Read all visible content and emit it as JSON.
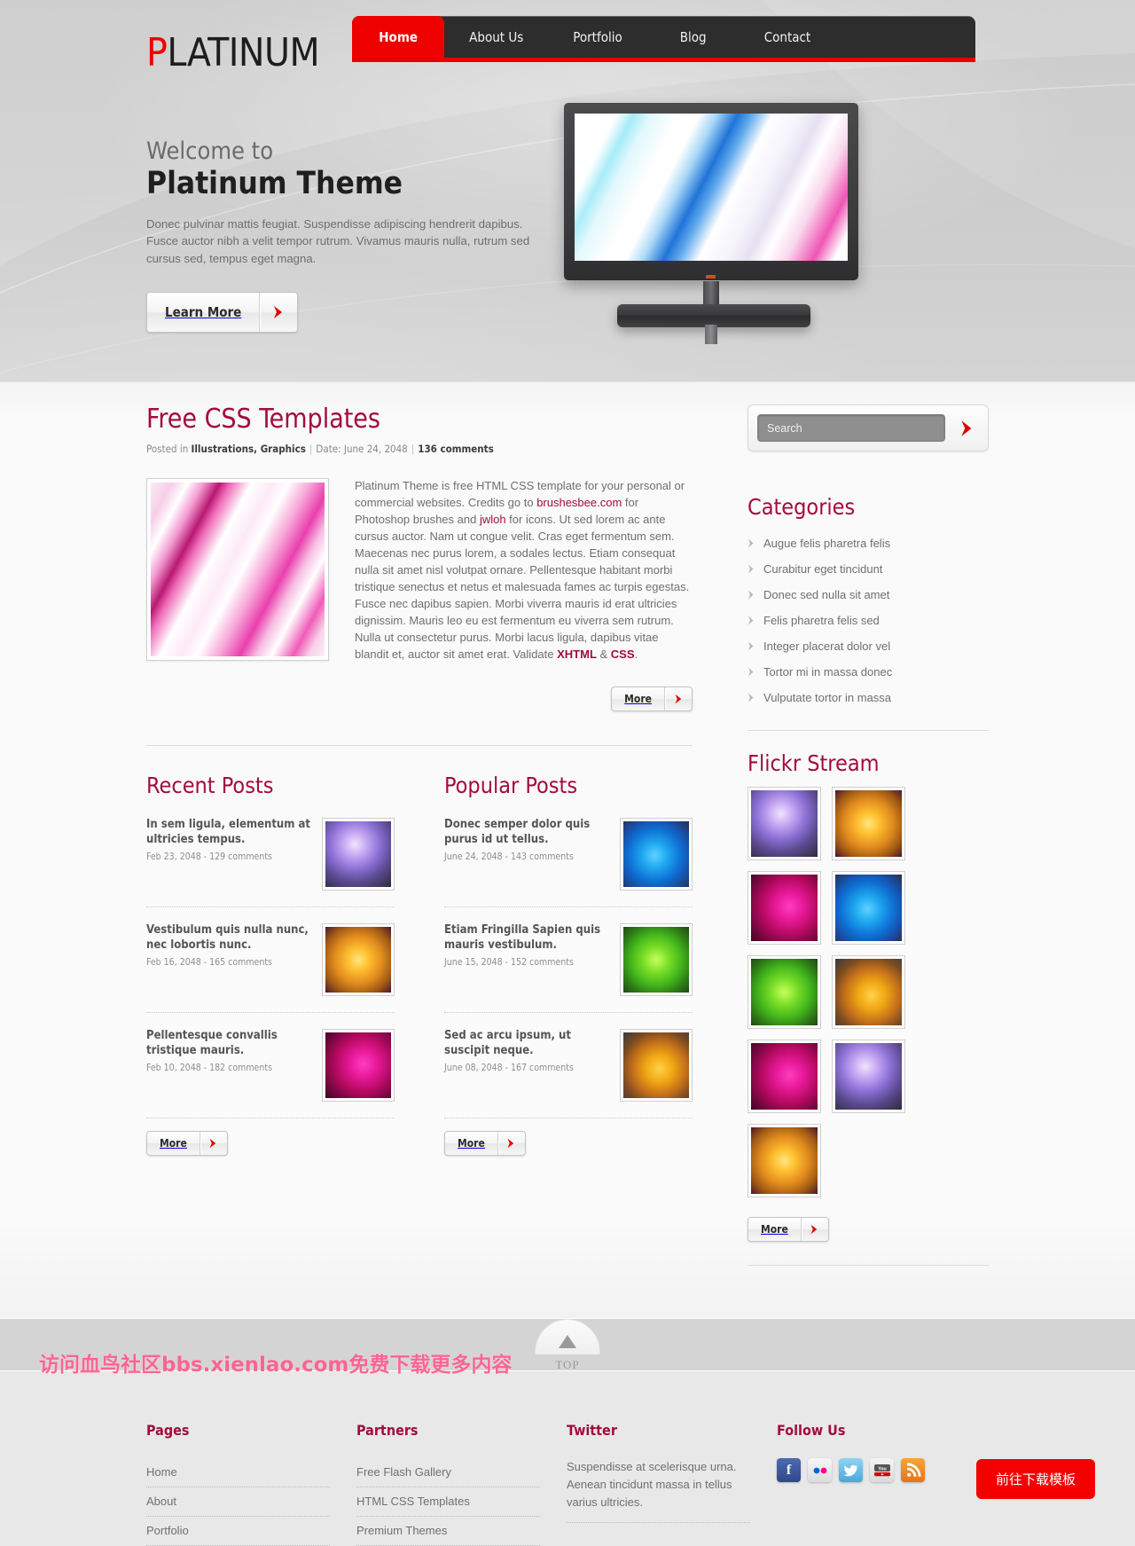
{
  "brand": {
    "first_letter": "P",
    "rest": "LATINUM"
  },
  "nav": [
    {
      "label": "Home",
      "active": true
    },
    {
      "label": "About Us",
      "active": false
    },
    {
      "label": "Portfolio",
      "active": false
    },
    {
      "label": "Blog",
      "active": false
    },
    {
      "label": "Contact",
      "active": false
    }
  ],
  "hero": {
    "subtitle": "Welcome to",
    "title": "Platinum Theme",
    "paragraph": "Donec pulvinar mattis feugiat. Suspendisse adipiscing hendrerit dapibus. Fusce auctor nibh a velit tempor rutrum. Vivamus mauris nulla, rutrum sed cursus sed, tempus eget magna.",
    "cta_label": "Learn More"
  },
  "post": {
    "title": "Free CSS Templates",
    "meta_prefix": "Posted in ",
    "categories": "Illustrations, Graphics",
    "date": "Date: June 24, 2048",
    "comments": "136 comments",
    "body_1": "Platinum Theme is free HTML CSS template for your personal or commercial websites. Credits go to ",
    "link_1": "brushesbee.com",
    "body_2": " for Photoshop brushes and ",
    "link_2": "jwloh",
    "body_3": " for icons. Ut sed lorem ac ante cursus auctor. Nam ut congue velit. Cras eget fermentum sem. Maecenas nec purus lorem, a sodales lectus. Etiam consequat nulla sit amet nisl volutpat ornare. Pellentesque habitant morbi tristique senectus et netus et malesuada fames ac turpis egestas. Fusce nec dapibus sapien. Morbi viverra mauris id erat ultricies dignissim. Mauris leo eu est fermentum eu viverra sem rutrum. Nulla ut consectetur purus. Morbi lacus ligula, dapibus vitae blandit et, auctor sit amet erat. Validate ",
    "strong_1": "XHTML",
    "body_4": " & ",
    "strong_2": "CSS",
    "body_5": ".",
    "more_label": "More"
  },
  "recent": {
    "title": "Recent Posts",
    "more_label": "More",
    "items": [
      {
        "title": "In sem ligula, elementum at ultricies tempus.",
        "meta": "Feb 23, 2048 - 129 comments",
        "thumb": "tex-purple"
      },
      {
        "title": "Vestibulum quis nulla nunc, nec lobortis nunc.",
        "meta": "Feb 16, 2048 - 165 comments",
        "thumb": "tex-orange"
      },
      {
        "title": "Pellentesque convallis tristique mauris.",
        "meta": "Feb 10, 2048 - 182 comments",
        "thumb": "tex-magenta"
      }
    ]
  },
  "popular": {
    "title": "Popular Posts",
    "more_label": "More",
    "items": [
      {
        "title": "Donec semper dolor quis purus id ut tellus.",
        "meta": "June 24, 2048 - 143 comments",
        "thumb": "tex-blue"
      },
      {
        "title": "Etiam Fringilla Sapien quis mauris vestibulum.",
        "meta": "June 15, 2048 - 152 comments",
        "thumb": "tex-green"
      },
      {
        "title": "Sed ac arcu ipsum, ut suscipit neque.",
        "meta": "June 08, 2048 - 167 comments",
        "thumb": "tex-amber"
      }
    ]
  },
  "search": {
    "placeholder": "Search",
    "value": ""
  },
  "categories": {
    "title": "Categories",
    "items": [
      "Augue felis pharetra felis",
      "Curabitur eget tincidunt",
      "Donec sed nulla sit amet",
      "Felis pharetra felis sed",
      "Integer placerat dolor vel",
      "Tortor mi in massa donec",
      "Vulputate tortor in massa"
    ]
  },
  "flickr": {
    "title": "Flickr Stream",
    "more_label": "More",
    "thumbs": [
      "tex-purple",
      "tex-orange",
      "tex-magenta",
      "tex-blue",
      "tex-green",
      "tex-amber",
      "tex-magenta",
      "tex-purple",
      "tex-orange"
    ]
  },
  "top": {
    "label": "TOP"
  },
  "footer": {
    "pages": {
      "title": "Pages",
      "items": [
        "Home",
        "About",
        "Portfolio"
      ]
    },
    "partners": {
      "title": "Partners",
      "items": [
        "Free Flash Gallery",
        "HTML CSS Templates",
        "Premium Themes"
      ]
    },
    "twitter": {
      "title": "Twitter",
      "text": "Suspendisse at scelerisque urna. Aenean tincidunt massa in tellus varius ultricies."
    },
    "follow": {
      "title": "Follow Us",
      "icons": [
        "facebook-icon",
        "flickr-icon",
        "twitter-icon",
        "youtube-icon",
        "rss-icon"
      ]
    }
  },
  "download_button": {
    "label": "前往下载模板"
  },
  "watermark": {
    "text": "访问血鸟社区bbs.xienlao.com免费下载更多内容"
  },
  "colors": {
    "accent_red": "#ef0000",
    "heading_maroon": "#a30c3c",
    "nav_bg": "#2d2d2d"
  }
}
